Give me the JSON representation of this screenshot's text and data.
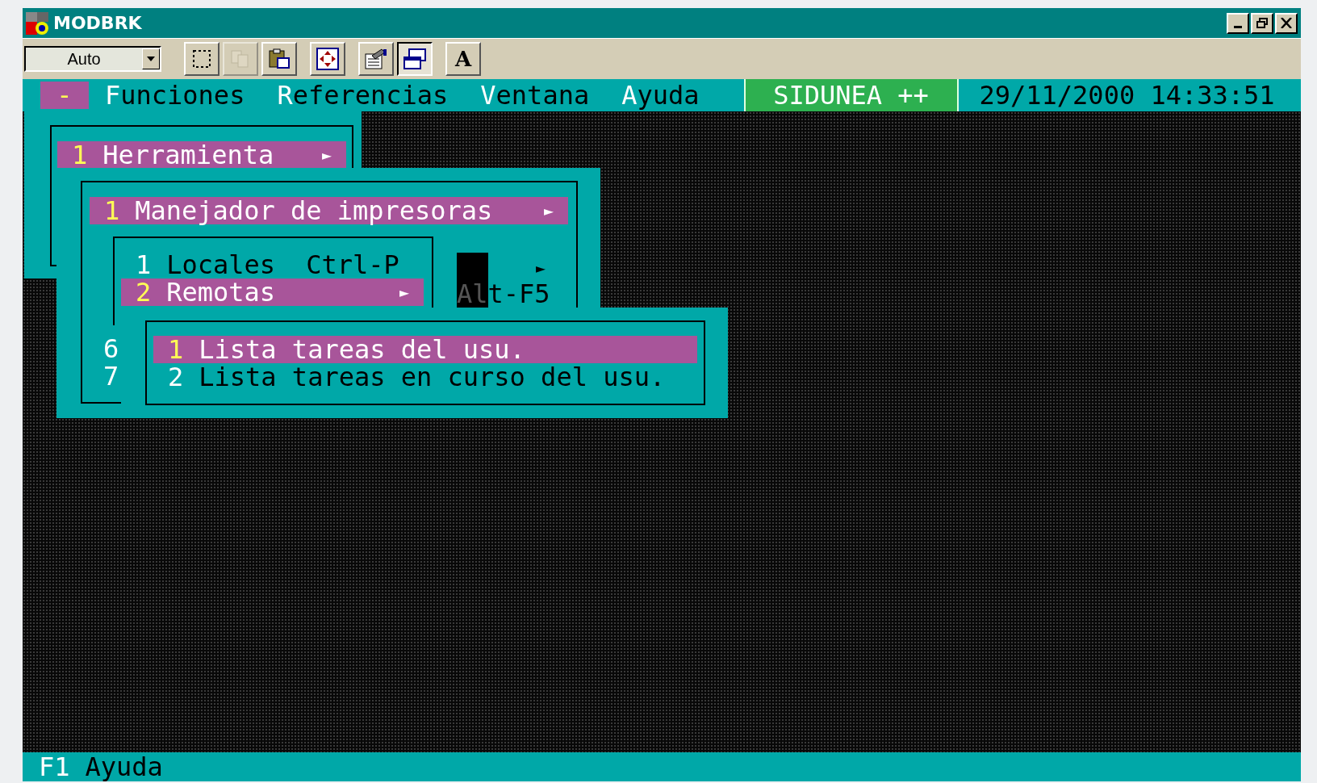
{
  "window": {
    "title": "MODBRK"
  },
  "toolbar": {
    "font_size": "Auto",
    "buttons": [
      {
        "kind": "mark",
        "disabled": false,
        "pressed": false
      },
      {
        "kind": "copy",
        "disabled": true,
        "pressed": false
      },
      {
        "kind": "paste",
        "disabled": false,
        "pressed": false
      },
      {
        "kind": "fullscreen",
        "disabled": false,
        "pressed": false
      },
      {
        "kind": "properties",
        "disabled": false,
        "pressed": false
      },
      {
        "kind": "background",
        "disabled": false,
        "pressed": true
      },
      {
        "kind": "font",
        "label": "A",
        "disabled": false,
        "pressed": false
      }
    ]
  },
  "menu_bar": {
    "system": "-",
    "items": [
      {
        "label": "Funciones"
      },
      {
        "label": "Referencias"
      },
      {
        "label": "Ventana"
      },
      {
        "label": "Ayuda"
      }
    ],
    "app_name": "SIDUNEA ++",
    "datetime": "29/11/2000 14:33:51"
  },
  "menus": [
    {
      "items": [
        {
          "number": "1",
          "label": "Herramienta",
          "arrow": "►",
          "selected": true
        }
      ]
    },
    {
      "items": [
        {
          "number": "1",
          "label": "Manejador de impresoras",
          "arrow": "►",
          "selected": true
        }
      ],
      "fragments": {
        "arrow": "►",
        "shortcut": "Alt-F5",
        "numbers": [
          "6",
          "7"
        ]
      }
    },
    {
      "items": [
        {
          "number": "1",
          "label": "Locales",
          "shortcut": "Ctrl-P",
          "selected": false
        },
        {
          "number": "2",
          "label": "Remotas",
          "arrow": "►",
          "selected": true
        }
      ]
    },
    {
      "items": [
        {
          "number": "1",
          "label": "Lista tareas del usu.",
          "selected": true
        },
        {
          "number": "2",
          "label": "Lista tareas en curso del usu.",
          "selected": false
        }
      ]
    }
  ],
  "status_bar": {
    "key": "F1",
    "label": "Ayuda"
  }
}
